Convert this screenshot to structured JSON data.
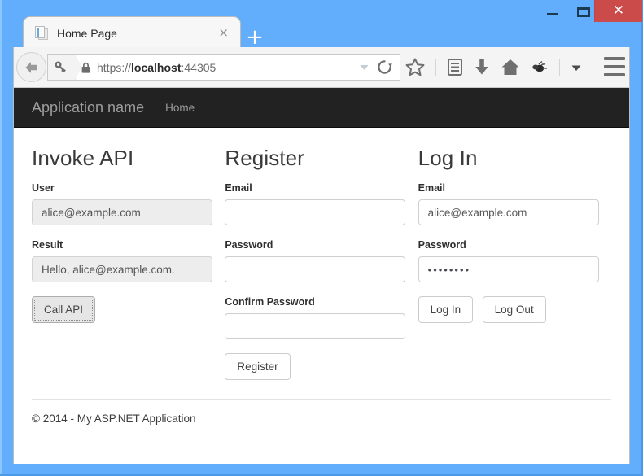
{
  "window": {
    "minimize_label": "—",
    "maximize_label": "❐",
    "close_label": "✕",
    "frame_color": "#62aefc",
    "close_color": "#cb4b4b"
  },
  "browser": {
    "tab": {
      "title": "Home Page",
      "close_label": "×",
      "favicon": "document-favicon"
    },
    "new_tab_label": "+",
    "back_label": "←",
    "url": {
      "scheme": "https://",
      "host": "localhost",
      "port": ":44305",
      "full": "https://localhost:44305"
    },
    "toolbar_icons": [
      "dropdown-arrow-icon",
      "reload-icon",
      "bookmark-star-icon",
      "reader-list-icon",
      "download-arrow-icon",
      "home-icon",
      "extension-icon",
      "extension-dropdown-icon",
      "hamburger-menu-icon"
    ]
  },
  "app": {
    "navbar": {
      "brand": "Application name",
      "links": [
        {
          "label": "Home"
        }
      ]
    },
    "columns": [
      {
        "id": "invoke-api",
        "heading": "Invoke API",
        "fields": [
          {
            "id": "user",
            "label": "User",
            "value": "alice@example.com",
            "placeholder": "",
            "disabled": true,
            "type": "text"
          },
          {
            "id": "result",
            "label": "Result",
            "value": "Hello, alice@example.com.",
            "placeholder": "",
            "disabled": true,
            "type": "text"
          }
        ],
        "buttons": [
          {
            "id": "call-api",
            "label": "Call API",
            "focused": true
          }
        ]
      },
      {
        "id": "register",
        "heading": "Register",
        "fields": [
          {
            "id": "register-email",
            "label": "Email",
            "value": "",
            "placeholder": "",
            "disabled": false,
            "type": "text"
          },
          {
            "id": "register-password",
            "label": "Password",
            "value": "",
            "placeholder": "",
            "disabled": false,
            "type": "password"
          },
          {
            "id": "register-confirm-password",
            "label": "Confirm Password",
            "value": "",
            "placeholder": "",
            "disabled": false,
            "type": "password"
          }
        ],
        "buttons": [
          {
            "id": "register",
            "label": "Register",
            "focused": false
          }
        ]
      },
      {
        "id": "log-in",
        "heading": "Log In",
        "fields": [
          {
            "id": "login-email",
            "label": "Email",
            "value": "alice@example.com",
            "placeholder": "",
            "disabled": false,
            "type": "text"
          },
          {
            "id": "login-password",
            "label": "Password",
            "value": "••••••••",
            "placeholder": "",
            "disabled": false,
            "type": "password"
          }
        ],
        "buttons": [
          {
            "id": "log-in",
            "label": "Log In",
            "focused": false
          },
          {
            "id": "log-out",
            "label": "Log Out",
            "focused": false
          }
        ]
      }
    ],
    "footer": {
      "copyright": "© 2014 - My ASP.NET Application"
    }
  }
}
